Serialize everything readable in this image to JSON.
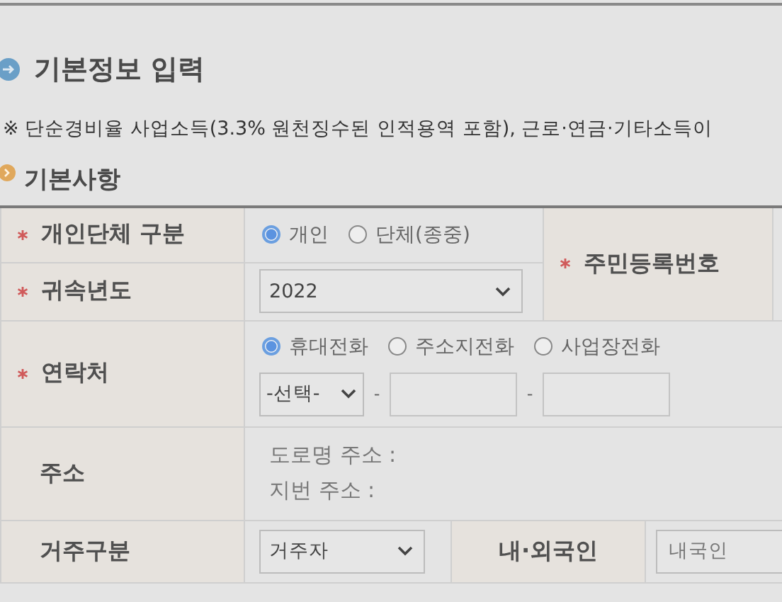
{
  "page_title": "기본정보 입력",
  "notice": "※ 단순경비율 사업소득(3.3% 원천징수된 인적용역 포함), 근로·연금·기타소득이",
  "section_title": "기본사항",
  "form": {
    "person_type": {
      "label": "개인단체 구분",
      "required": true,
      "options": [
        {
          "label": "개인",
          "selected": true
        },
        {
          "label": "단체(종중)",
          "selected": false
        }
      ]
    },
    "tax_year": {
      "label": "귀속년도",
      "required": true,
      "value": "2022"
    },
    "resident_number": {
      "label": "주민등록번호",
      "required": true
    },
    "contact": {
      "label": "연락처",
      "required": true,
      "options": [
        {
          "label": "휴대전화",
          "selected": true
        },
        {
          "label": "주소지전화",
          "selected": false
        },
        {
          "label": "사업장전화",
          "selected": false
        }
      ],
      "area_code": "-선택-",
      "separators": [
        "-",
        "-"
      ]
    },
    "address": {
      "label": "주소",
      "required": false,
      "lines": [
        "도로명 주소 :",
        "지번 주소 :"
      ]
    },
    "residency": {
      "label": "거주구분",
      "required": false,
      "value": "거주자"
    },
    "nationality": {
      "label": "내·외국인",
      "required": false,
      "value": "내국인"
    }
  }
}
